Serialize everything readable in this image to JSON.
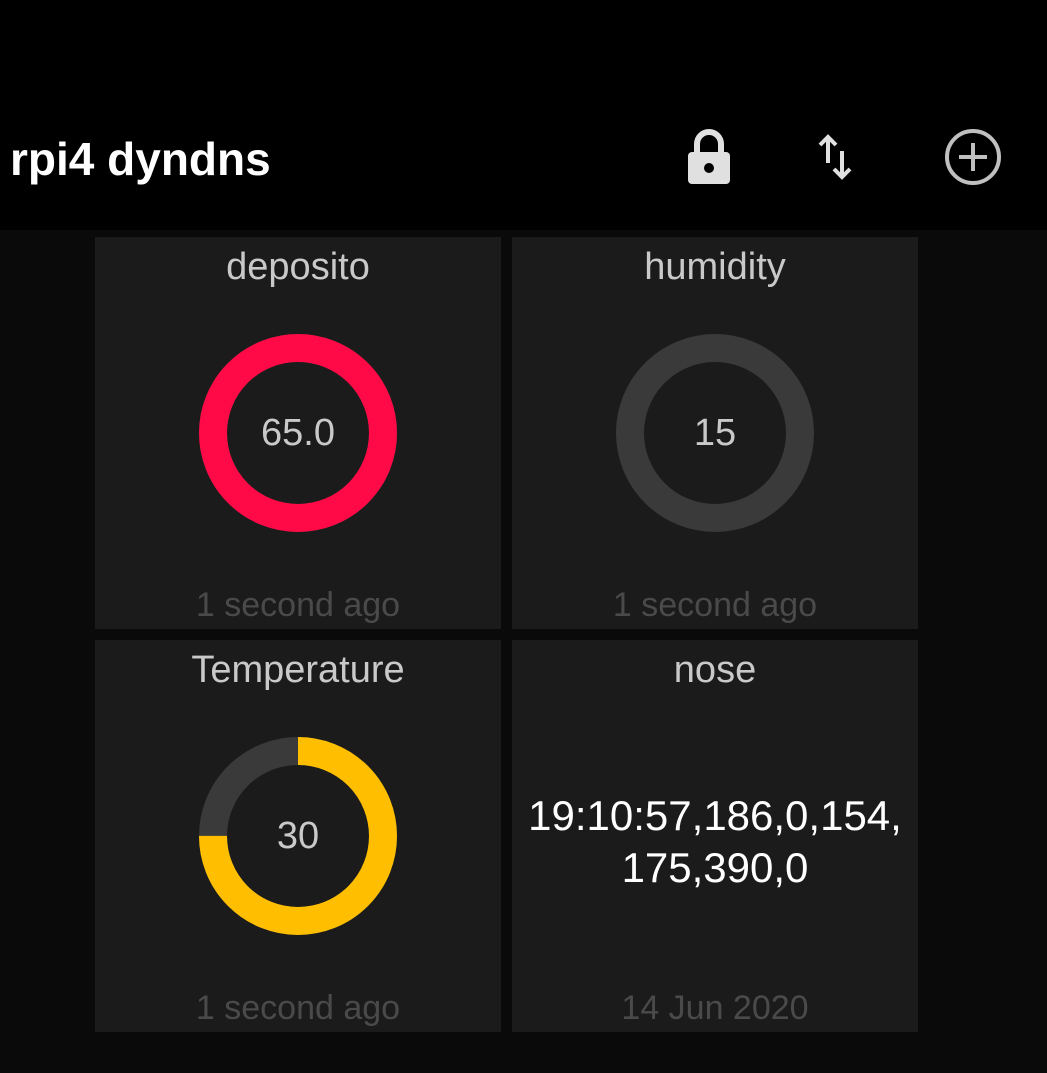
{
  "app_bar": {
    "title": "rpi4 dyndns",
    "actions": [
      "lock-icon",
      "sort-icon",
      "add-circle-icon"
    ]
  },
  "colors": {
    "accent_red": "#ff0a47",
    "accent_amber": "#ffbf00",
    "track_gray": "#3a3a3a",
    "tile_bg": "#1b1b1b"
  },
  "tiles": [
    {
      "title": "deposito",
      "type": "gauge",
      "value": "65.0",
      "fill_fraction": 1.0,
      "color": "#ff0a47",
      "updated": "1 second ago"
    },
    {
      "title": "humidity",
      "type": "gauge",
      "value": "15",
      "fill_fraction": 0.0,
      "color": "#3a3a3a",
      "updated": "1 second ago"
    },
    {
      "title": "Temperature",
      "type": "gauge",
      "value": "30",
      "fill_fraction": 0.75,
      "color": "#ffbf00",
      "updated": "1 second ago"
    },
    {
      "title": "nose",
      "type": "text",
      "value_line1": "19:10:57,186,0,154,",
      "value_line2": "175,390,0",
      "updated": "14 Jun 2020"
    }
  ]
}
